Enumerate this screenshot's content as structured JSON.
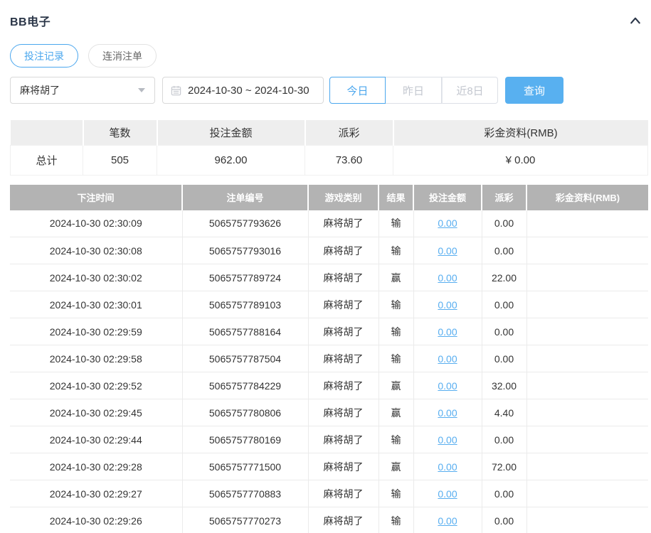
{
  "header": {
    "title": "BB电子"
  },
  "tabs": [
    {
      "label": "投注记录",
      "active": true
    },
    {
      "label": "连消注单",
      "active": false
    }
  ],
  "filters": {
    "game_select": {
      "value": "麻将胡了"
    },
    "date_range": {
      "value": "2024-10-30 ~ 2024-10-30"
    },
    "quick_ranges": [
      {
        "label": "今日",
        "active": true
      },
      {
        "label": "昨日",
        "active": false
      },
      {
        "label": "近8日",
        "active": false
      }
    ],
    "search_label": "查询"
  },
  "summary": {
    "columns": [
      "",
      "笔数",
      "投注金额",
      "派彩",
      "彩金资料(RMB)"
    ],
    "row": {
      "label": "总计",
      "count": "505",
      "bet_amount": "962.00",
      "payout": "73.60",
      "bonus": "¥ 0.00"
    }
  },
  "records": {
    "columns": [
      "下注时间",
      "注单编号",
      "游戏类别",
      "结果",
      "投注金额",
      "派彩",
      "彩金资料(RMB)"
    ],
    "rows": [
      {
        "time": "2024-10-30 02:30:09",
        "bet_no": "5065757793626",
        "game": "麻将胡了",
        "result": "输",
        "bet_amount": "0.00",
        "payout": "0.00",
        "bonus": ""
      },
      {
        "time": "2024-10-30 02:30:08",
        "bet_no": "5065757793016",
        "game": "麻将胡了",
        "result": "输",
        "bet_amount": "0.00",
        "payout": "0.00",
        "bonus": ""
      },
      {
        "time": "2024-10-30 02:30:02",
        "bet_no": "5065757789724",
        "game": "麻将胡了",
        "result": "赢",
        "bet_amount": "0.00",
        "payout": "22.00",
        "bonus": ""
      },
      {
        "time": "2024-10-30 02:30:01",
        "bet_no": "5065757789103",
        "game": "麻将胡了",
        "result": "输",
        "bet_amount": "0.00",
        "payout": "0.00",
        "bonus": ""
      },
      {
        "time": "2024-10-30 02:29:59",
        "bet_no": "5065757788164",
        "game": "麻将胡了",
        "result": "输",
        "bet_amount": "0.00",
        "payout": "0.00",
        "bonus": ""
      },
      {
        "time": "2024-10-30 02:29:58",
        "bet_no": "5065757787504",
        "game": "麻将胡了",
        "result": "输",
        "bet_amount": "0.00",
        "payout": "0.00",
        "bonus": ""
      },
      {
        "time": "2024-10-30 02:29:52",
        "bet_no": "5065757784229",
        "game": "麻将胡了",
        "result": "赢",
        "bet_amount": "0.00",
        "payout": "32.00",
        "bonus": ""
      },
      {
        "time": "2024-10-30 02:29:45",
        "bet_no": "5065757780806",
        "game": "麻将胡了",
        "result": "赢",
        "bet_amount": "0.00",
        "payout": "4.40",
        "bonus": ""
      },
      {
        "time": "2024-10-30 02:29:44",
        "bet_no": "5065757780169",
        "game": "麻将胡了",
        "result": "输",
        "bet_amount": "0.00",
        "payout": "0.00",
        "bonus": ""
      },
      {
        "time": "2024-10-30 02:29:28",
        "bet_no": "5065757771500",
        "game": "麻将胡了",
        "result": "赢",
        "bet_amount": "0.00",
        "payout": "72.00",
        "bonus": ""
      },
      {
        "time": "2024-10-30 02:29:27",
        "bet_no": "5065757770883",
        "game": "麻将胡了",
        "result": "输",
        "bet_amount": "0.00",
        "payout": "0.00",
        "bonus": ""
      },
      {
        "time": "2024-10-30 02:29:26",
        "bet_no": "5065757770273",
        "game": "麻将胡了",
        "result": "输",
        "bet_amount": "0.00",
        "payout": "0.00",
        "bonus": ""
      }
    ]
  },
  "colors": {
    "accent": "#4ba7ee",
    "query_button_bg": "#58b0f0",
    "link": "#58aef0",
    "records_header_bg": "#b3b3b3",
    "summary_header_bg": "#eeeeee",
    "title_text": "#2b3648"
  }
}
